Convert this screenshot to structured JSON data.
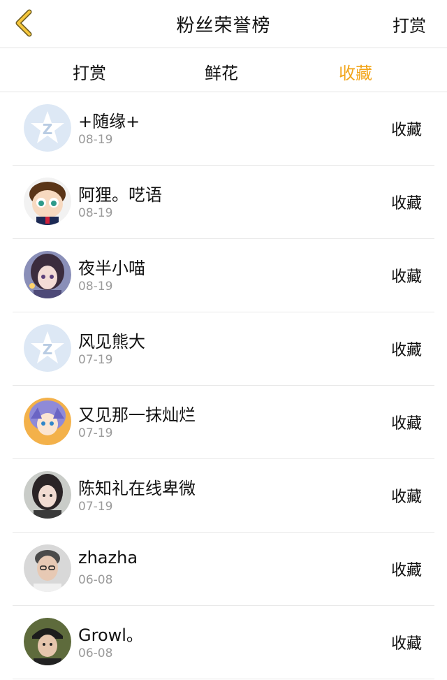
{
  "header": {
    "title": "粉丝荣誉榜",
    "right_label": "打赏",
    "back_icon": "chevron-left-icon",
    "accent": "#f2a51a"
  },
  "tabs": [
    {
      "label": "打赏",
      "active": false
    },
    {
      "label": "鲜花",
      "active": false
    },
    {
      "label": "收藏",
      "active": true
    }
  ],
  "fans": [
    {
      "name": "+随缘+",
      "date": "08-19",
      "action": "收藏",
      "avatar": "default-qq-avatar"
    },
    {
      "name": "阿狸。呓语",
      "date": "08-19",
      "action": "收藏",
      "avatar": "cartoon-boy-avatar"
    },
    {
      "name": "夜半小喵",
      "date": "08-19",
      "action": "收藏",
      "avatar": "anime-girl-avatar"
    },
    {
      "name": "风见熊大",
      "date": "07-19",
      "action": "收藏",
      "avatar": "default-qq-avatar"
    },
    {
      "name": "又见那一抹灿烂",
      "date": "07-19",
      "action": "收藏",
      "avatar": "anime-character-avatar"
    },
    {
      "name": "陈知礼在线卑微",
      "date": "07-19",
      "action": "收藏",
      "avatar": "photo-girl-avatar"
    },
    {
      "name": "zhazha",
      "date": "06-08",
      "action": "收藏",
      "avatar": "photo-boy-avatar"
    },
    {
      "name": "Growl。",
      "date": "06-08",
      "action": "收藏",
      "avatar": "photo-cap-avatar"
    }
  ]
}
